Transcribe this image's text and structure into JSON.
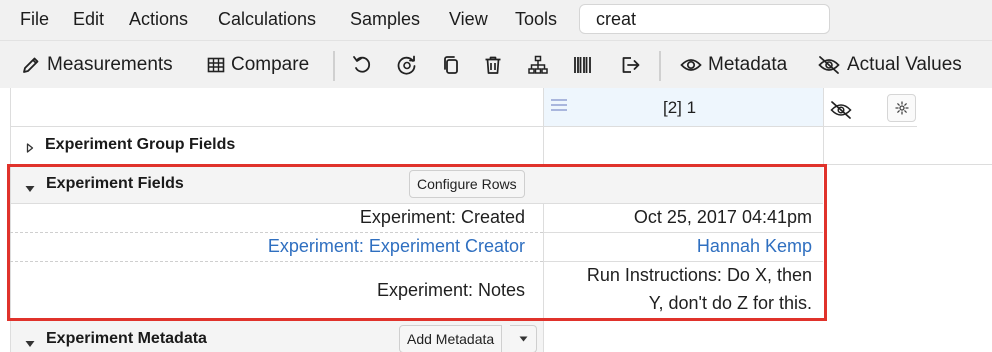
{
  "menu": {
    "items": [
      "File",
      "Edit",
      "Actions",
      "Calculations",
      "Samples",
      "View",
      "Tools"
    ]
  },
  "search": {
    "value": "creat"
  },
  "toolbar": {
    "measurements_label": "Measurements",
    "compare_label": "Compare",
    "metadata_label": "Metadata",
    "actual_values_label": "Actual Values",
    "icons": [
      "undo-icon",
      "refresh-icon",
      "copy-icon",
      "trash-icon",
      "hierarchy-icon",
      "barcode-icon",
      "export-icon"
    ]
  },
  "column_header": {
    "sample": "[2] 1"
  },
  "groups": {
    "experiment_group_fields": "Experiment Group Fields",
    "experiment_fields": "Experiment Fields",
    "configure_rows": "Configure Rows",
    "experiment_metadata": "Experiment Metadata",
    "add_metadata": "Add Metadata"
  },
  "rows": [
    {
      "label": "Experiment: Created",
      "value": "Oct 25, 2017 04:41pm",
      "link": false
    },
    {
      "label": "Experiment: Experiment Creator",
      "value": "Hannah Kemp",
      "link": true
    },
    {
      "label": "Experiment: Notes",
      "value_line1": "Run Instructions: Do X, then",
      "value_line2": "Y, don't do Z for this.",
      "link": false
    }
  ],
  "colors": {
    "link": "#2f6fc0",
    "highlight": "#e0322b",
    "selected_col": "#eef6fd"
  }
}
